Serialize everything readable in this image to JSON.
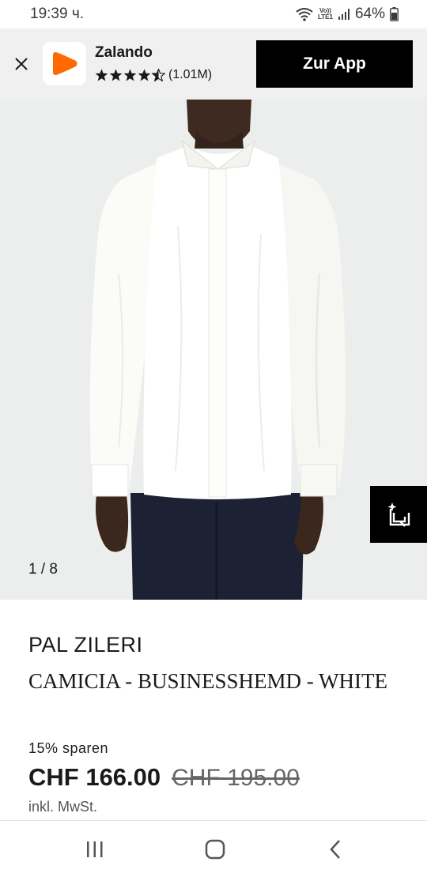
{
  "status_bar": {
    "time": "19:39 ч.",
    "network_top": "Vo))",
    "network_bottom": "LTE1",
    "battery": "64%"
  },
  "app_banner": {
    "app_name": "Zalando",
    "rating_count": "(1.01M)",
    "rating_stars": 4.5,
    "cta_label": "Zur App",
    "brand_color": "#ff6900"
  },
  "gallery": {
    "counter": "1 / 8"
  },
  "product": {
    "brand": "PAL ZILERI",
    "name": "CAMICIA - BUSINESSHEMD - WHITE",
    "discount": "15% sparen",
    "price_current": "CHF 166.00",
    "price_original": "CHF 195.00",
    "vat_note": "inkl. MwSt."
  },
  "icons": {
    "close": "close-icon",
    "favorite": "save-to-wishlist-icon",
    "nav_recents": "recents-icon",
    "nav_home": "home-icon",
    "nav_back": "back-icon"
  }
}
